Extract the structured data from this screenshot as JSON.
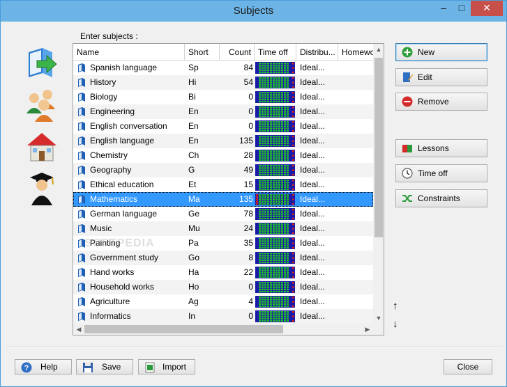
{
  "window": {
    "title": "Subjects",
    "minimize": "–",
    "maximize": "□",
    "close": "✕"
  },
  "enter_label": "Enter subjects :",
  "columns": [
    "Name",
    "Short",
    "Count",
    "Time off",
    "Distribu...",
    "Homewo"
  ],
  "rows": [
    {
      "name": "Spanish language",
      "short": "Sp",
      "count": "84",
      "dist": "Ideal..."
    },
    {
      "name": "History",
      "short": "Hi",
      "count": "54",
      "dist": "Ideal..."
    },
    {
      "name": "Biology",
      "short": "Bi",
      "count": "0",
      "dist": "Ideal..."
    },
    {
      "name": "Engineering",
      "short": "En",
      "count": "0",
      "dist": "Ideal..."
    },
    {
      "name": "English conversation",
      "short": "En",
      "count": "0",
      "dist": "Ideal..."
    },
    {
      "name": "English language",
      "short": "En",
      "count": "135",
      "dist": "Ideal..."
    },
    {
      "name": "Chemistry",
      "short": "Ch",
      "count": "28",
      "dist": "Ideal..."
    },
    {
      "name": "Geography",
      "short": "G",
      "count": "49",
      "dist": "Ideal..."
    },
    {
      "name": "Ethical education",
      "short": "Et",
      "count": "15",
      "dist": "Ideal..."
    },
    {
      "name": "Mathematics",
      "short": "Ma",
      "count": "135",
      "dist": "Ideal...",
      "selected": true
    },
    {
      "name": "German language",
      "short": "Ge",
      "count": "78",
      "dist": "Ideal..."
    },
    {
      "name": "Music",
      "short": "Mu",
      "count": "24",
      "dist": "Ideal..."
    },
    {
      "name": "Painting",
      "short": "Pa",
      "count": "35",
      "dist": "Ideal..."
    },
    {
      "name": "Government study",
      "short": "Go",
      "count": "8",
      "dist": "Ideal..."
    },
    {
      "name": "Hand works",
      "short": "Ha",
      "count": "22",
      "dist": "Ideal..."
    },
    {
      "name": "Household works",
      "short": "Ho",
      "count": "0",
      "dist": "Ideal..."
    },
    {
      "name": "Agriculture",
      "short": "Ag",
      "count": "4",
      "dist": "Ideal..."
    },
    {
      "name": "Informatics",
      "short": "In",
      "count": "0",
      "dist": "Ideal..."
    }
  ],
  "buttons": {
    "new": "New",
    "edit": "Edit",
    "remove": "Remove",
    "lessons": "Lessons",
    "time_off": "Time off",
    "constraints": "Constraints",
    "help": "Help",
    "save": "Save",
    "import": "Import",
    "close": "Close"
  },
  "move": {
    "up": "↑",
    "down": "↓"
  },
  "watermark": "SOFTPEDIA",
  "colors": {
    "selection": "#3399ff",
    "titlebar": "#6cb4e6",
    "timeoff_green": "#22c02a",
    "timeoff_blue": "#1a1aa8",
    "timeoff_red": "#d02020"
  },
  "sidebar_icons": [
    "book-arrow-icon",
    "teachers-group-icon",
    "school-house-icon",
    "graduate-icon"
  ]
}
